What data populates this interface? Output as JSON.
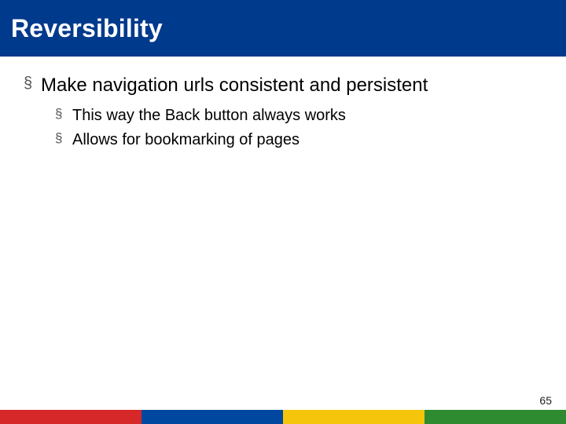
{
  "title": "Reversibility",
  "bullets": [
    {
      "text": "Make navigation urls consistent and persistent",
      "children": [
        {
          "text": "This way the Back button always works"
        },
        {
          "text": "Allows for bookmarking of pages"
        }
      ]
    }
  ],
  "page_number": "65",
  "stripe_colors": {
    "red": "#d62828",
    "blue": "#0047a0",
    "yellow": "#f4c50a",
    "green": "#2f8b2f"
  }
}
